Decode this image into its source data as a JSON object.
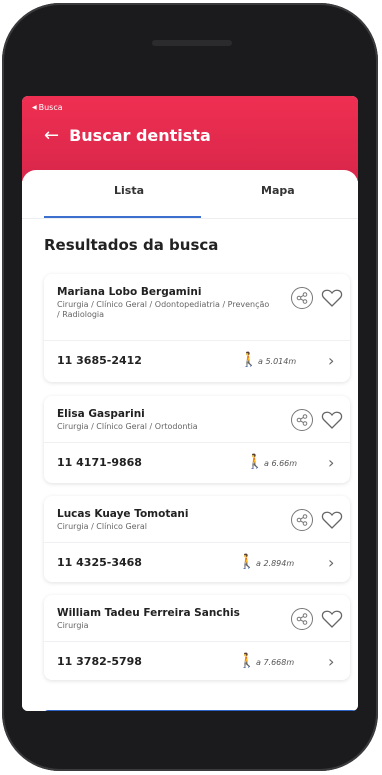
{
  "header": {
    "back_small_label": "Busca",
    "title": "Buscar dentista"
  },
  "tabs": [
    {
      "label": "Lista",
      "active": true
    },
    {
      "label": "Mapa",
      "active": false
    }
  ],
  "results_title": "Resultados da busca",
  "colors": {
    "header": "#e4294d",
    "accent": "#3d6fcf"
  },
  "results": [
    {
      "name": "Mariana Lobo Bergamini",
      "specialties": "Cirurgia / Clínico Geral / Odontopediatria / Prevenção / Radiologia",
      "phone": "11 3685-2412",
      "distance": "a 5.014m"
    },
    {
      "name": "Elisa Gasparini",
      "specialties": "Cirurgia / Clínico Geral / Ortodontia",
      "phone": "11 4171-9868",
      "distance": "a 6.66m"
    },
    {
      "name": "Lucas Kuaye Tomotani",
      "specialties": "Cirurgia / Clínico Geral",
      "phone": "11 4325-3468",
      "distance": "a 2.894m"
    },
    {
      "name": "William Tadeu Ferreira Sanchis",
      "specialties": "Cirurgia",
      "phone": "11 3782-5798",
      "distance": "a 7.668m"
    }
  ]
}
